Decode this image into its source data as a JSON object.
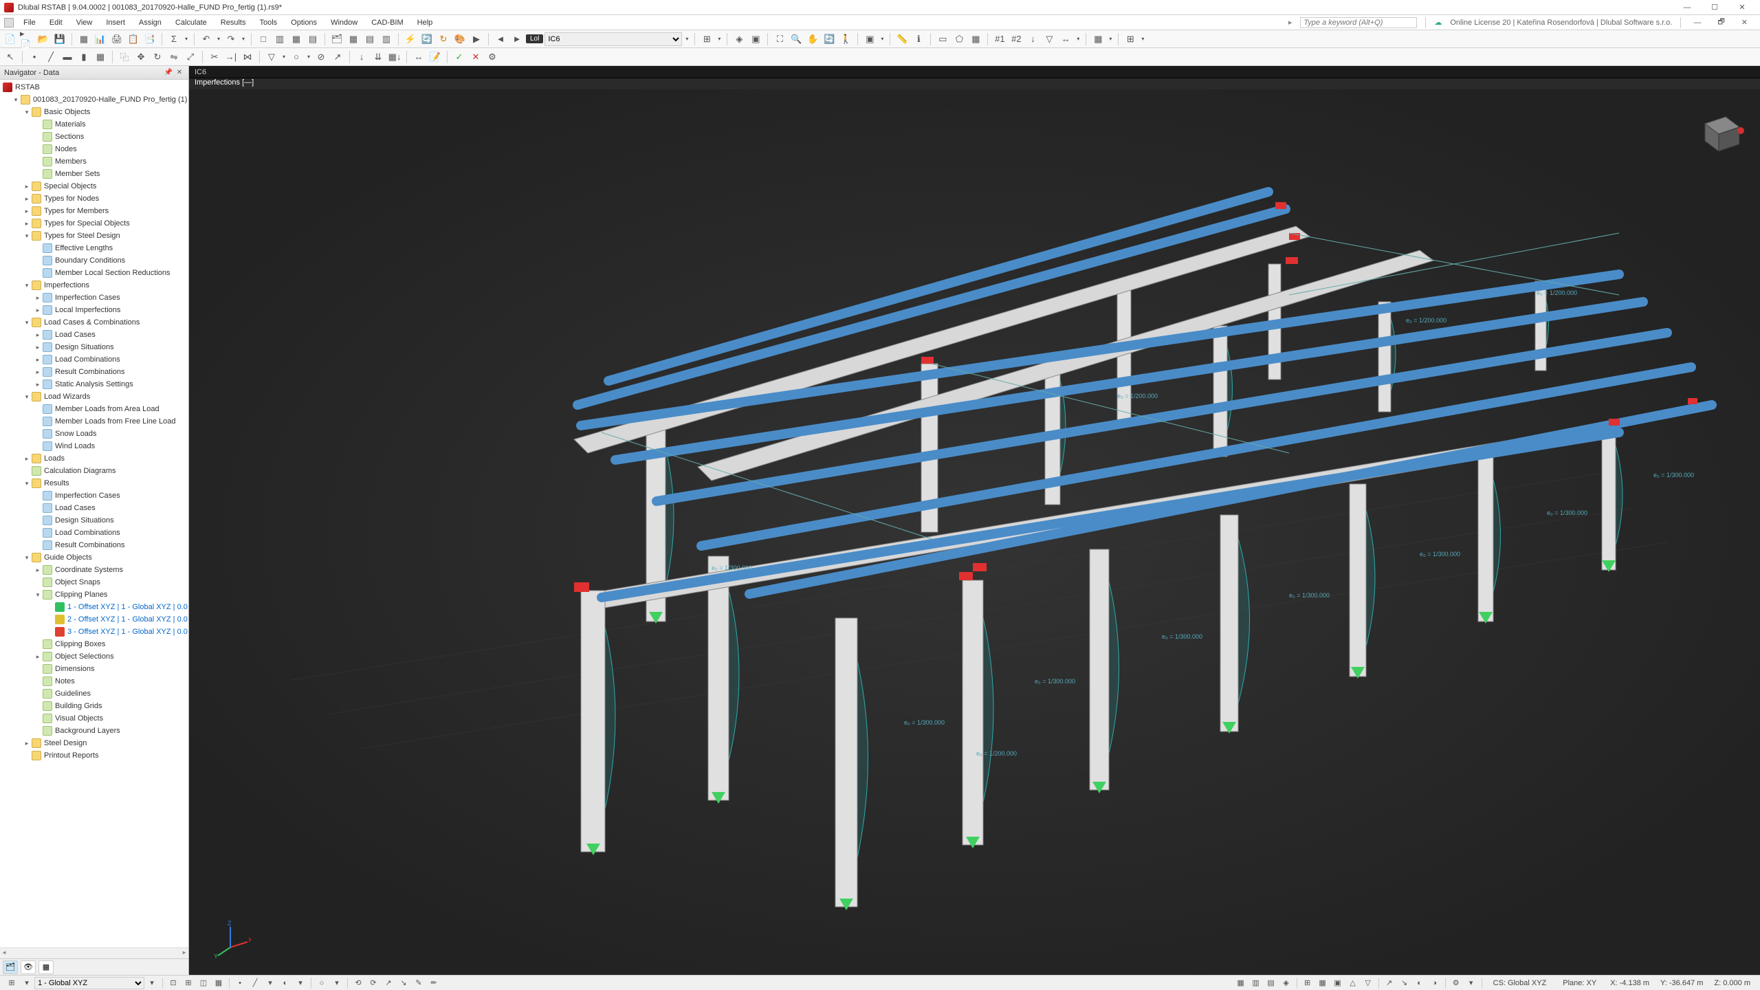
{
  "title": "Dlubal RSTAB | 9.04.0002 | 001083_20170920-Halle_FUND Pro_fertig (1).rs9*",
  "menu": [
    "File",
    "Edit",
    "View",
    "Insert",
    "Assign",
    "Calculate",
    "Results",
    "Tools",
    "Options",
    "Window",
    "CAD-BIM",
    "Help"
  ],
  "keyword_placeholder": "Type a keyword (Alt+Q)",
  "license": "Online License 20 | Kateřina Rosendorfová | Dlubal Software s.r.o.",
  "toolbar_label": "Lol",
  "loadcase_combo": "IC6",
  "navigator": {
    "title": "Navigator - Data",
    "root": "RSTAB",
    "project": "001083_20170920-Halle_FUND Pro_fertig (1)",
    "basic_objects": {
      "label": "Basic Objects",
      "children": [
        "Materials",
        "Sections",
        "Nodes",
        "Members",
        "Member Sets"
      ]
    },
    "top_folders": [
      "Special Objects",
      "Types for Nodes",
      "Types for Members",
      "Types for Special Objects"
    ],
    "steel_design": {
      "label": "Types for Steel Design",
      "children": [
        "Effective Lengths",
        "Boundary Conditions",
        "Member Local Section Reductions"
      ]
    },
    "imperfections": {
      "label": "Imperfections",
      "children": [
        "Imperfection Cases",
        "Local Imperfections"
      ]
    },
    "load_cases": {
      "label": "Load Cases & Combinations",
      "children": [
        "Load Cases",
        "Design Situations",
        "Load Combinations",
        "Result Combinations",
        "Static Analysis Settings"
      ]
    },
    "load_wizards": {
      "label": "Load Wizards",
      "children": [
        "Member Loads from Area Load",
        "Member Loads from Free Line Load",
        "Snow Loads",
        "Wind Loads"
      ]
    },
    "loads": "Loads",
    "calc_diagrams": "Calculation Diagrams",
    "results": {
      "label": "Results",
      "children": [
        "Imperfection Cases",
        "Load Cases",
        "Design Situations",
        "Load Combinations",
        "Result Combinations"
      ]
    },
    "guide_objects": {
      "label": "Guide Objects",
      "children": [
        "Coordinate Systems",
        "Object Snaps"
      ],
      "clipping_planes": {
        "label": "Clipping Planes",
        "items": [
          "1 - Offset XYZ | 1 - Global XYZ | 0.0",
          "2 - Offset XYZ | 1 - Global XYZ | 0.0",
          "3 - Offset XYZ | 1 - Global XYZ | 0.0"
        ]
      },
      "rest": [
        "Clipping Boxes",
        "Object Selections",
        "Dimensions",
        "Notes",
        "Guidelines",
        "Building Grids",
        "Visual Objects",
        "Background Layers"
      ]
    },
    "bottom": [
      "Steel Design",
      "Printout Reports"
    ]
  },
  "viewport": {
    "tab": "IC6",
    "info": "Imperfections [—]",
    "annotation": "e₀ = 1/300.000",
    "annotation2": "e₀ = 1/200.000"
  },
  "statusbar": {
    "cs_select": "1 - Global XYZ",
    "cs_label": "CS: Global XYZ",
    "plane": "Plane: XY",
    "x": "X: -4.138 m",
    "y": "Y: -36.647 m",
    "z": "Z: 0.000 m"
  }
}
